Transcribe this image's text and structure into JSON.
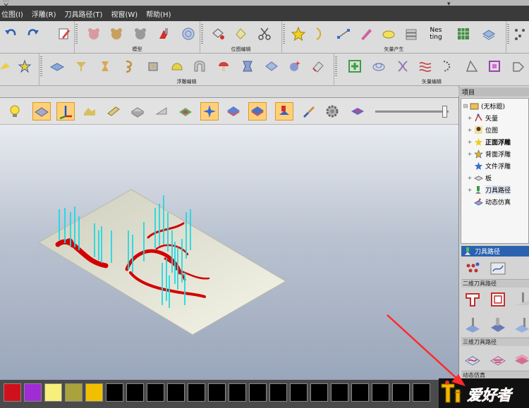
{
  "window": {
    "title_fragment": "…"
  },
  "menu": [
    "位图(I)",
    "浮雕(R)",
    "刀具路径(T)",
    "视窗(W)",
    "帮助(H)"
  ],
  "toolbar_groups_top": [
    "模型",
    "位图编辑",
    "矢量产生"
  ],
  "toolbar_groups_second": [
    "浮雕编辑",
    "矢量编辑"
  ],
  "toolbar_icons": {
    "nesting_label": "Nes ting"
  },
  "doc_tab": {
    "close": "×",
    "dropdown": "▾"
  },
  "view_slider": {
    "level": 0.95
  },
  "project_panel": {
    "header": "项目",
    "tree": [
      {
        "label": "(无标题)",
        "expander": "⊟",
        "icon": "model-icon"
      },
      {
        "label": "矢量",
        "expander": "+",
        "icon": "vector-icon"
      },
      {
        "label": "位图",
        "expander": "+",
        "icon": "bitmap-icon"
      },
      {
        "label": "正面浮雕",
        "expander": "+",
        "icon": "front-relief-icon",
        "bold": true
      },
      {
        "label": "背面浮雕",
        "expander": "+",
        "icon": "back-relief-icon"
      },
      {
        "label": "文件浮雕",
        "expander": "",
        "icon": "file-relief-icon"
      },
      {
        "label": "板",
        "expander": "+",
        "icon": "board-icon"
      },
      {
        "label": "刀具路径",
        "expander": "+",
        "icon": "toolpath-icon",
        "selected": true
      },
      {
        "label": "动态仿真",
        "expander": "",
        "icon": "simulation-icon"
      }
    ]
  },
  "toolpath_panel": {
    "header": "刀具路径",
    "sections": [
      "二维刀具路径",
      "三维刀具路径",
      "动态仿真"
    ]
  },
  "palette": [
    "#d0101c",
    "#a02cd6",
    "#f6f07a",
    "#aaa23c",
    "#f0c000",
    "#000000",
    "#000000",
    "#000000",
    "#000000",
    "#000000",
    "#000000",
    "#000000",
    "#000000",
    "#000000",
    "#000000",
    "#000000",
    "#000000",
    "#000000",
    "#000000",
    "#000000",
    "#000000"
  ],
  "watermark": {
    "text": "爱好者"
  },
  "colors": {
    "accent_blue": "#2a62b0",
    "active_orange": "#ffd07a",
    "toolpath_cyan": "#20d8e0",
    "relief_red": "#d40000"
  }
}
